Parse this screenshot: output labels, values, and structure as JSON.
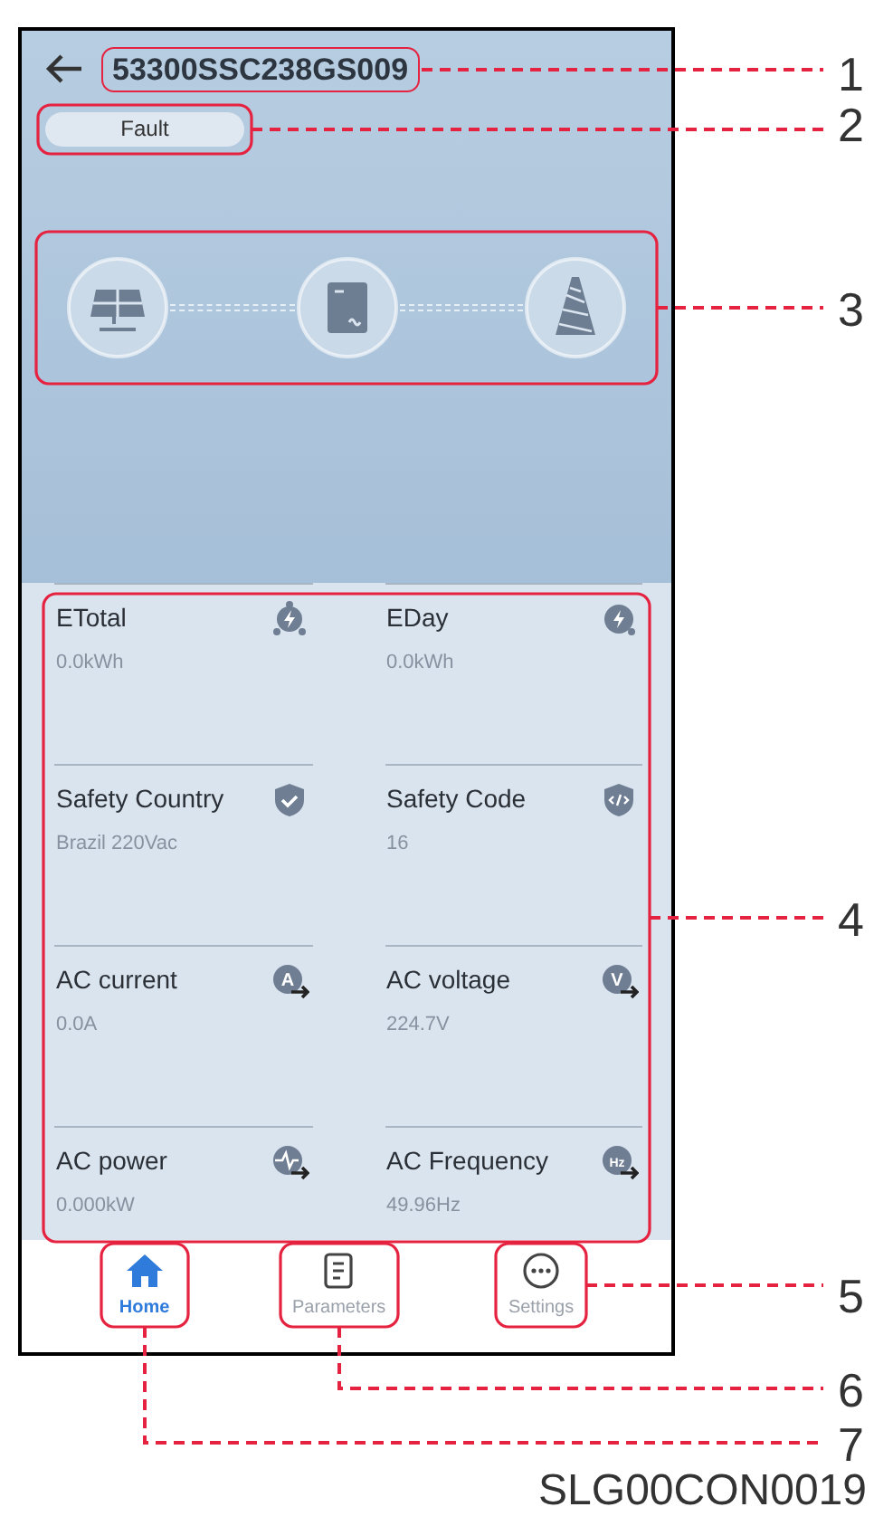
{
  "header": {
    "title": "53300SSC238GS009",
    "status": "Fault"
  },
  "flow": [
    {
      "kind": "solar"
    },
    {
      "kind": "inverter"
    },
    {
      "kind": "grid"
    }
  ],
  "cards": [
    {
      "label": "ETotal",
      "value": "0.0kWh",
      "kind": "total"
    },
    {
      "label": "EDay",
      "value": "0.0kWh",
      "kind": "day"
    },
    {
      "label": "Safety Country",
      "value": "Brazil 220Vac",
      "kind": "country"
    },
    {
      "label": "Safety Code",
      "value": "16",
      "kind": "code"
    },
    {
      "label": "AC current",
      "value": "0.0A",
      "kind": "letter",
      "icon_letter": "A"
    },
    {
      "label": "AC voltage",
      "value": "224.7V",
      "kind": "letter",
      "icon_letter": "V"
    },
    {
      "label": "AC power",
      "value": "0.000kW",
      "kind": "power"
    },
    {
      "label": "AC Frequency",
      "value": "49.96Hz",
      "kind": "letter",
      "icon_letter": "Hz"
    }
  ],
  "nav": [
    {
      "label": "Home",
      "kind": "home",
      "selected": true
    },
    {
      "label": "Parameters",
      "kind": "parameters",
      "selected": false
    },
    {
      "label": "Settings",
      "kind": "settings",
      "selected": false
    }
  ],
  "callouts": [
    {
      "number": "1"
    },
    {
      "number": "2"
    },
    {
      "number": "3"
    },
    {
      "number": "4"
    },
    {
      "number": "5"
    },
    {
      "number": "6"
    },
    {
      "number": "7"
    }
  ],
  "figure_code": "SLG00CON0019"
}
